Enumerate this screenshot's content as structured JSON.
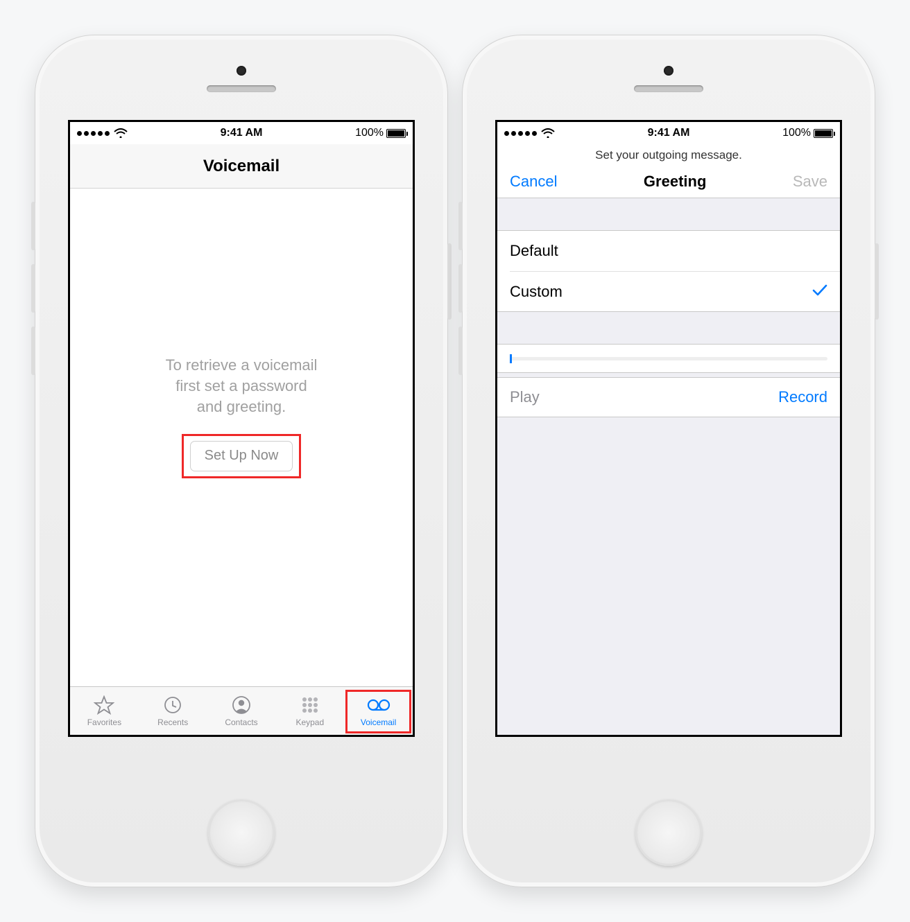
{
  "status": {
    "time": "9:41 AM",
    "battery_text": "100%"
  },
  "left": {
    "title": "Voicemail",
    "message_line1": "To retrieve a voicemail",
    "message_line2": "first set a password",
    "message_line3": "and greeting.",
    "setup_button": "Set Up Now",
    "tabs": [
      {
        "key": "favorites",
        "label": "Favorites",
        "selected": false
      },
      {
        "key": "recents",
        "label": "Recents",
        "selected": false
      },
      {
        "key": "contacts",
        "label": "Contacts",
        "selected": false
      },
      {
        "key": "keypad",
        "label": "Keypad",
        "selected": false
      },
      {
        "key": "voicemail",
        "label": "Voicemail",
        "selected": true
      }
    ]
  },
  "right": {
    "prompt": "Set your outgoing message.",
    "cancel": "Cancel",
    "title": "Greeting",
    "save": "Save",
    "options": [
      {
        "key": "default",
        "label": "Default",
        "selected": false
      },
      {
        "key": "custom",
        "label": "Custom",
        "selected": true
      }
    ],
    "progress_value": 0,
    "play_label": "Play",
    "record_label": "Record"
  }
}
